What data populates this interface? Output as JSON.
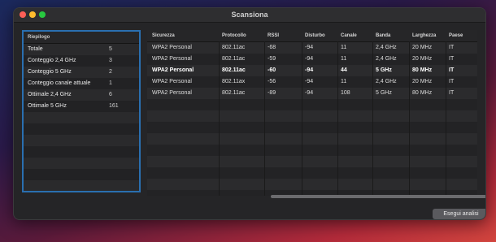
{
  "window": {
    "title": "Scansiona"
  },
  "summary": {
    "header": "Riepilogo",
    "rows": [
      {
        "label": "Totale",
        "value": "5"
      },
      {
        "label": "Conteggio 2,4 GHz",
        "value": "3"
      },
      {
        "label": "Conteggio 5 GHz",
        "value": "2"
      },
      {
        "label": "Conteggio canale attuale",
        "value": "1"
      },
      {
        "label": "Ottimale 2,4 GHz",
        "value": "6"
      },
      {
        "label": "Ottimale 5 GHz",
        "value": "161"
      }
    ]
  },
  "table": {
    "headers": [
      "Sicurezza",
      "Protocollo",
      "RSSI",
      "Disturbo",
      "Canale",
      "Banda",
      "Larghezza",
      "Paese"
    ],
    "rows": [
      [
        "WPA2 Personal",
        "802.11ac",
        "-68",
        "-94",
        "11",
        "2,4 GHz",
        "20 MHz",
        "IT"
      ],
      [
        "WPA2 Personal",
        "802.11ac",
        "-59",
        "-94",
        "11",
        "2,4 GHz",
        "20 MHz",
        "IT"
      ],
      [
        "WPA2 Personal",
        "802.11ac",
        "-60",
        "-94",
        "44",
        "5 GHz",
        "80 MHz",
        "IT"
      ],
      [
        "WPA2 Personal",
        "802.11ax",
        "-56",
        "-94",
        "11",
        "2,4 GHz",
        "20 MHz",
        "IT"
      ],
      [
        "WPA2 Personal",
        "802.11ac",
        "-89",
        "-94",
        "108",
        "5 GHz",
        "80 MHz",
        "IT"
      ]
    ],
    "bold_row_index": 2
  },
  "footer": {
    "button_label": "Esegui analisi"
  }
}
